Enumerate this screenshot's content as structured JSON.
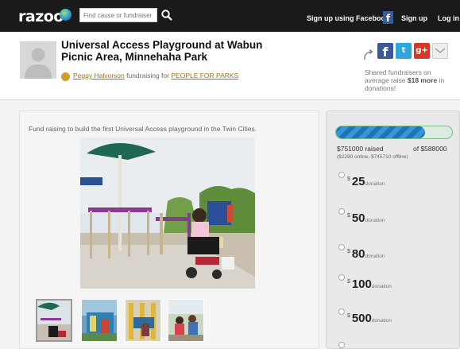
{
  "topbar": {
    "logo": "razoo",
    "search_placeholder": "Find cause or fundraiser",
    "facebook_signup": "Sign up using Facebook",
    "signup": "Sign up",
    "login": "Log in"
  },
  "campaign": {
    "title": "Universal Access Playground at Wabun Picnic Area, Minnehaha Park",
    "fundraiser_name": "Peggy Halvorson",
    "fundraising_for_text": "fundraising for",
    "organization": "PEOPLE FOR PARKS"
  },
  "share": {
    "text_prefix": "Shared fundraisers on average raise",
    "text_amount": "$18 more",
    "text_suffix": "in donations!"
  },
  "description": "Fund raising to build the first Universal Access playground in the Twin Cities.",
  "progress": {
    "fraction": 0.77,
    "raised": "$751000 raised",
    "goal": "of $588000",
    "breakdown": "($2290 online, $745710 offline)"
  },
  "donations": {
    "currency": "$",
    "label": "donation",
    "amounts": [
      "25",
      "50",
      "80",
      "100",
      "500"
    ]
  },
  "colors": {
    "topbar": "#1a1a1a",
    "facebook": "#3b5998",
    "twitter": "#2fa6de",
    "googleplus": "#d2382b",
    "progress": "#1f74b5",
    "link": "#9a7418"
  }
}
